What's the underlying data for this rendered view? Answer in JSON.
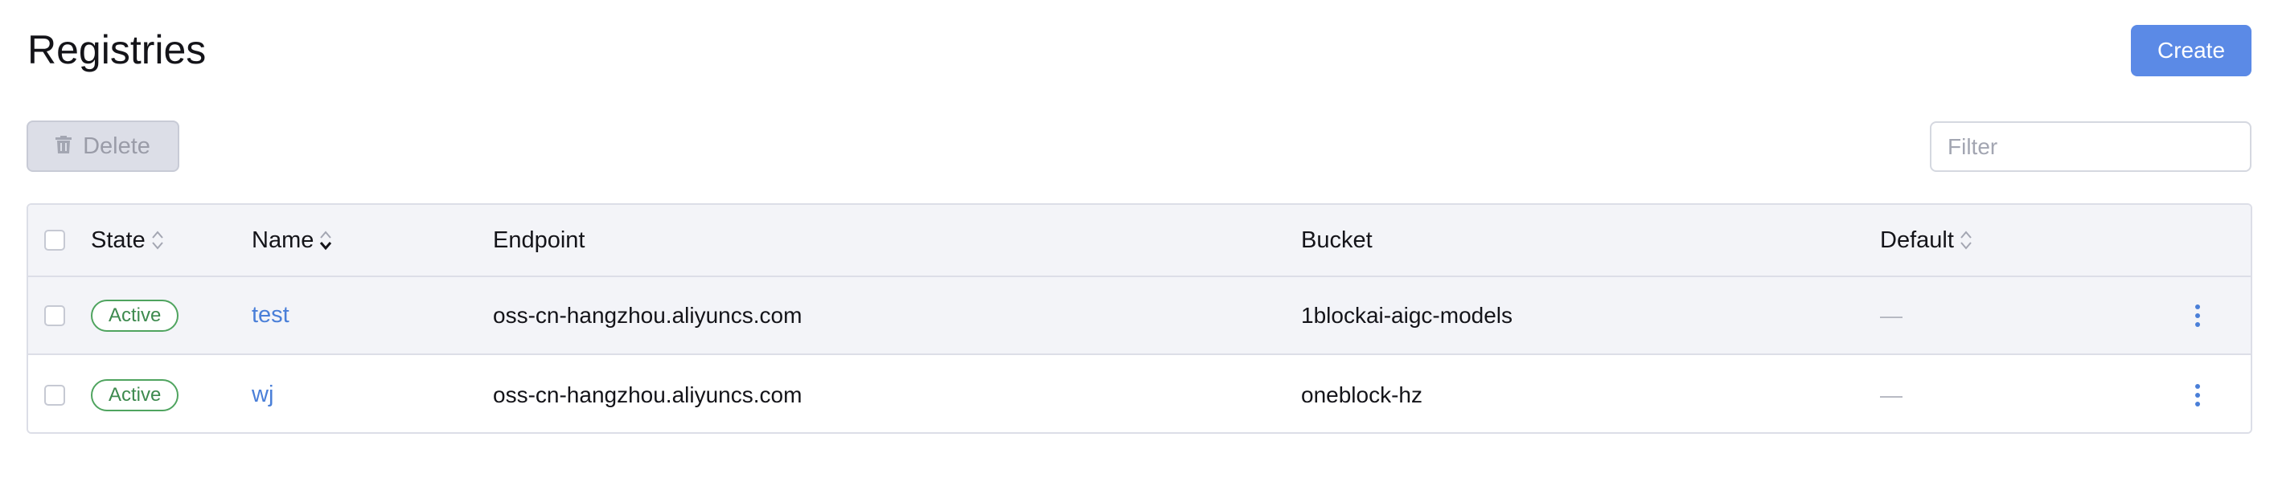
{
  "header": {
    "title": "Registries",
    "create_label": "Create"
  },
  "toolbar": {
    "delete_label": "Delete",
    "filter_placeholder": "Filter"
  },
  "table": {
    "columns": {
      "state": "State",
      "name": "Name",
      "endpoint": "Endpoint",
      "bucket": "Bucket",
      "default": "Default"
    },
    "rows": [
      {
        "state": "Active",
        "name": "test",
        "endpoint": "oss-cn-hangzhou.aliyuncs.com",
        "bucket": "1blockai-aigc-models",
        "default": "—"
      },
      {
        "state": "Active",
        "name": "wj",
        "endpoint": "oss-cn-hangzhou.aliyuncs.com",
        "bucket": "oneblock-hz",
        "default": "—"
      }
    ]
  },
  "colors": {
    "accent": "#5b8ae6",
    "link": "#4a7fd8",
    "active_badge": "#4fa45f",
    "header_bg": "#f3f4f8"
  },
  "icons": [
    "trash-icon",
    "sort-icon",
    "sort-desc-icon",
    "kebab-menu-icon"
  ]
}
